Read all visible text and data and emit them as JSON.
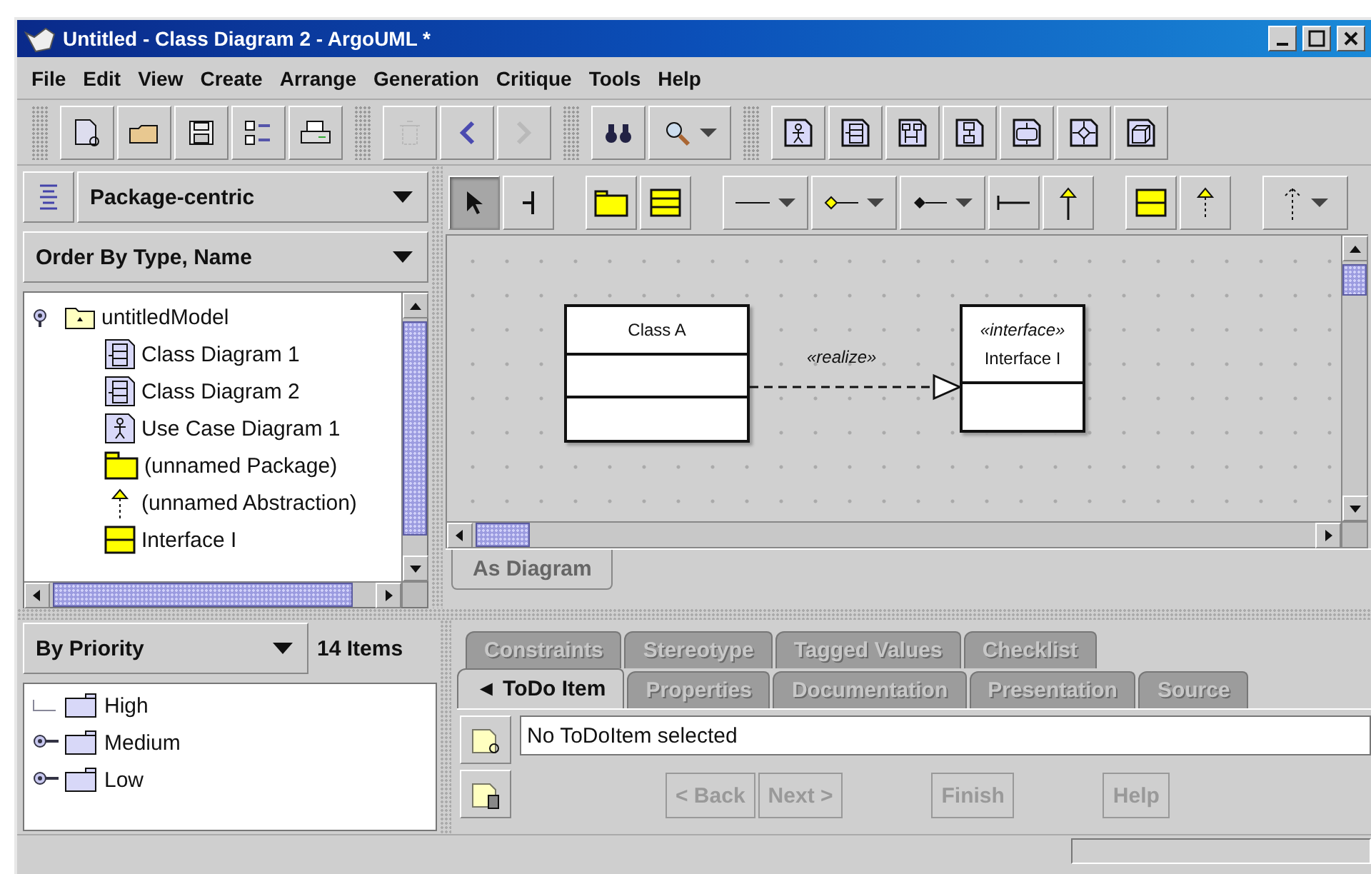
{
  "window": {
    "title": "Untitled - Class Diagram 2 - ArgoUML *"
  },
  "menu": [
    "File",
    "Edit",
    "View",
    "Create",
    "Arrange",
    "Generation",
    "Critique",
    "Tools",
    "Help"
  ],
  "toolbar": [
    [
      {
        "kind": "new",
        "disabled": false
      },
      {
        "kind": "open",
        "disabled": false
      },
      {
        "kind": "save",
        "disabled": false
      },
      {
        "kind": "properties",
        "disabled": false
      },
      {
        "kind": "print",
        "disabled": false
      }
    ],
    [
      {
        "kind": "delete",
        "disabled": true
      },
      {
        "kind": "back",
        "disabled": false
      },
      {
        "kind": "forward",
        "disabled": true
      }
    ],
    [
      {
        "kind": "find",
        "disabled": false
      },
      {
        "kind": "zoom",
        "disabled": false
      }
    ],
    [
      {
        "kind": "usecase",
        "disabled": false
      },
      {
        "kind": "classdiagram",
        "disabled": false
      },
      {
        "kind": "sequence",
        "disabled": false
      },
      {
        "kind": "state",
        "disabled": false
      },
      {
        "kind": "activity",
        "disabled": false
      },
      {
        "kind": "collaboration",
        "disabled": false
      },
      {
        "kind": "deployment",
        "disabled": false
      }
    ]
  ],
  "explorer": {
    "perspective": "Package-centric",
    "order": "Order By Type, Name",
    "tree": [
      {
        "label": "untitledModel",
        "kind": "model",
        "expanded": true,
        "children": [
          {
            "label": "Class Diagram 1",
            "kind": "classdiagram"
          },
          {
            "label": "Class Diagram 2",
            "kind": "classdiagram"
          },
          {
            "label": "Use Case Diagram 1",
            "kind": "usecase"
          },
          {
            "label": "(unnamed Package)",
            "kind": "package"
          },
          {
            "label": "(unnamed Abstraction)",
            "kind": "abstraction"
          },
          {
            "label": "Interface I",
            "kind": "interface"
          }
        ]
      }
    ]
  },
  "diagram_toolbar": [
    [
      {
        "kind": "select",
        "selected": true
      },
      {
        "kind": "broom",
        "selected": false
      }
    ],
    [
      {
        "kind": "package",
        "selected": false
      },
      {
        "kind": "class",
        "selected": false
      }
    ],
    [
      {
        "kind": "association",
        "selected": false
      },
      {
        "kind": "aggregation",
        "selected": false
      },
      {
        "kind": "composition",
        "selected": false
      },
      {
        "kind": "dependency",
        "selected": false
      },
      {
        "kind": "generalization",
        "selected": false
      }
    ],
    [
      {
        "kind": "interface",
        "selected": false
      },
      {
        "kind": "realization",
        "selected": false
      }
    ],
    [
      {
        "kind": "dashed-arrow",
        "selected": false
      }
    ]
  ],
  "diagram": {
    "nodes": [
      {
        "kind": "class",
        "name": "Class A"
      },
      {
        "kind": "interface",
        "stereotype": "«interface»",
        "name": "Interface I"
      }
    ],
    "edges": [
      {
        "kind": "realization",
        "label": "«realize»"
      }
    ]
  },
  "view_tabs": [
    {
      "label": "As Diagram",
      "selected": true
    }
  ],
  "todo": {
    "grouping": "By Priority",
    "count": "14 Items",
    "tree": [
      {
        "label": "High",
        "expandable": false
      },
      {
        "label": "Medium",
        "expandable": true
      },
      {
        "label": "Low",
        "expandable": true
      }
    ]
  },
  "details": {
    "tab_rows": [
      [
        {
          "label": "Constraints",
          "selected": false
        },
        {
          "label": "Stereotype",
          "selected": false
        },
        {
          "label": "Tagged Values",
          "selected": false
        },
        {
          "label": "Checklist",
          "selected": false
        }
      ],
      [
        {
          "label": "◄ ToDo Item",
          "selected": true
        },
        {
          "label": "Properties",
          "selected": false
        },
        {
          "label": "Documentation",
          "selected": false
        },
        {
          "label": "Presentation",
          "selected": false
        },
        {
          "label": "Source",
          "selected": false
        }
      ]
    ],
    "message": "No ToDoItem selected",
    "buttons": [
      {
        "label": "< Back",
        "disabled": true
      },
      {
        "label": "Next >",
        "disabled": true
      },
      {
        "label": "Finish",
        "disabled": true
      },
      {
        "label": "Help",
        "disabled": true
      }
    ]
  }
}
